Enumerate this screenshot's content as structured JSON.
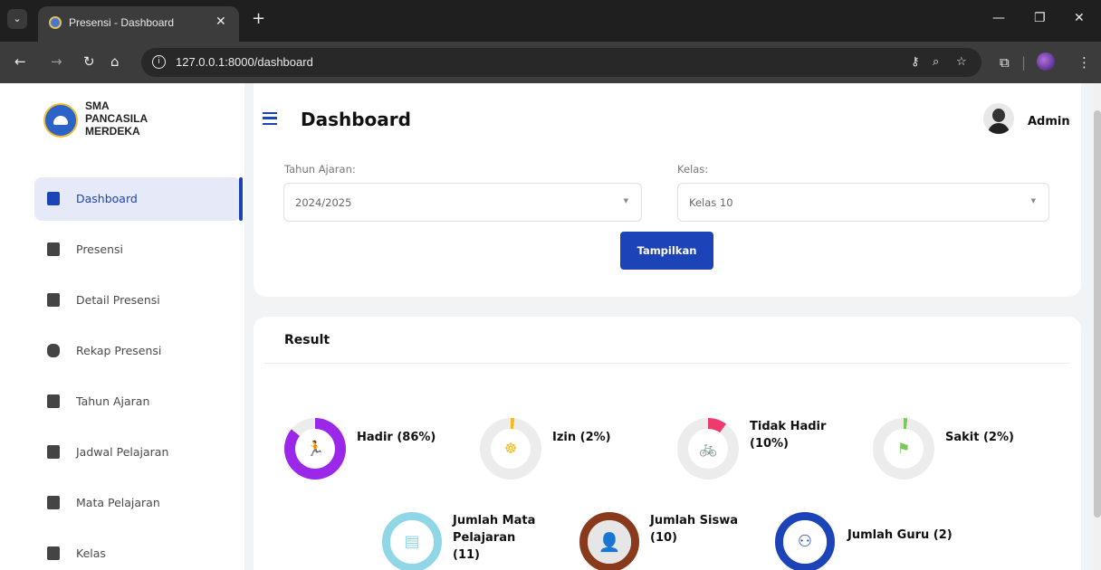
{
  "browser": {
    "tab_title": "Presensi - Dashboard",
    "url": "127.0.0.1:8000/dashboard"
  },
  "brand": {
    "lines": [
      "SMA",
      "PANCASILA",
      "MERDEKA"
    ]
  },
  "sidebar": {
    "items": [
      {
        "label": "Dashboard",
        "icon": "dashboard-icon",
        "active": true
      },
      {
        "label": "Presensi",
        "icon": "calendar-check-icon"
      },
      {
        "label": "Detail Presensi",
        "icon": "calendar-check-icon"
      },
      {
        "label": "Rekap Presensi",
        "icon": "database-icon"
      },
      {
        "label": "Tahun Ajaran",
        "icon": "calendar-icon"
      },
      {
        "label": "Jadwal Pelajaran",
        "icon": "calendar-grid-icon"
      },
      {
        "label": "Mata Pelajaran",
        "icon": "book-icon"
      },
      {
        "label": "Kelas",
        "icon": "building-icon"
      }
    ]
  },
  "header": {
    "title": "Dashboard",
    "user_name": "Admin"
  },
  "filters": {
    "tahun_label": "Tahun Ajaran:",
    "tahun_value": "2024/2025",
    "kelas_label": "Kelas:",
    "kelas_value": "Kelas 10",
    "submit_label": "Tampilkan"
  },
  "result": {
    "title": "Result",
    "stats": [
      {
        "label": "Hadir (86%)",
        "percent": 86,
        "color": "#9b27e8",
        "icon": "running-icon"
      },
      {
        "label": "Izin (2%)",
        "percent": 2,
        "color": "#f6b81a",
        "icon": "meditation-icon"
      },
      {
        "label": "Tidak Hadir (10%)",
        "percent": 10,
        "color": "#ee3a6d",
        "icon": "cycling-icon"
      },
      {
        "label": "Sakit (2%)",
        "percent": 2,
        "color": "#7ac75a",
        "icon": "flag-icon"
      }
    ],
    "totals": [
      {
        "label": "Jumlah Mata Pelajaran (11)",
        "color": "#8fd6e6",
        "icon": "subject-icon"
      },
      {
        "label": "Jumlah Siswa (10)",
        "color": "#8a3a1c",
        "icon": "student-icon"
      },
      {
        "label": "Jumlah Guru (2)",
        "color": "#1d43b8",
        "icon": "teacher-icon"
      }
    ]
  },
  "colors": {
    "accent": "#1d43b8"
  }
}
